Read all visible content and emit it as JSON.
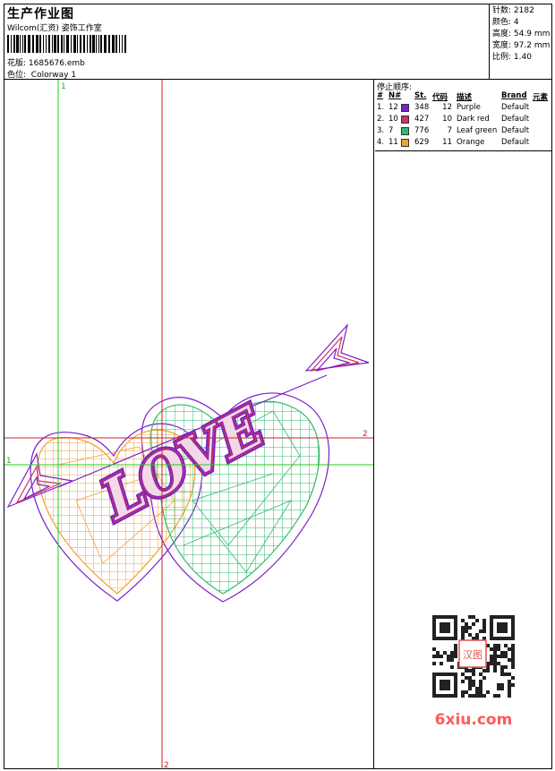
{
  "header": {
    "title": "生产作业图",
    "company": "Wilcom(汇资) 姿饰工作室",
    "design_label": "花版:",
    "design_value": "1685676.emb",
    "colorway_label": "色位:",
    "colorway_value": "Colorway 1"
  },
  "stats": {
    "stitches_label": "针数:",
    "stitches_value": "2182",
    "colors_label": "颜色:",
    "colors_value": "4",
    "height_label": "高度:",
    "height_value": "54.9 mm",
    "width_label": "宽度:",
    "width_value": "97.2 mm",
    "scale_label": "比例:",
    "scale_value": "1.40"
  },
  "stop_panel": {
    "title": "停止顺序:",
    "columns": [
      "#",
      "N#",
      "St.",
      "代码",
      "描述",
      "Brand",
      "元素"
    ],
    "rows": [
      {
        "idx": "1.",
        "needle": "12",
        "stitches": "348",
        "code": "12",
        "desc": "Purple",
        "brand": "Default",
        "color": "#7a1fc9"
      },
      {
        "idx": "2.",
        "needle": "10",
        "stitches": "427",
        "code": "10",
        "desc": "Dark red",
        "brand": "Default",
        "color": "#c8365a"
      },
      {
        "idx": "3.",
        "needle": "7",
        "stitches": "776",
        "code": "7",
        "desc": "Leaf green",
        "brand": "Default",
        "color": "#2fba6a"
      },
      {
        "idx": "4.",
        "needle": "11",
        "stitches": "629",
        "code": "11",
        "desc": "Orange",
        "brand": "Default",
        "color": "#f5a030"
      }
    ]
  },
  "canvas": {
    "axis_label_1": "1",
    "axis_label_2": "2",
    "design_text": "LOVE"
  },
  "watermark": {
    "site": "6xiu.com",
    "seal": "汉图"
  }
}
